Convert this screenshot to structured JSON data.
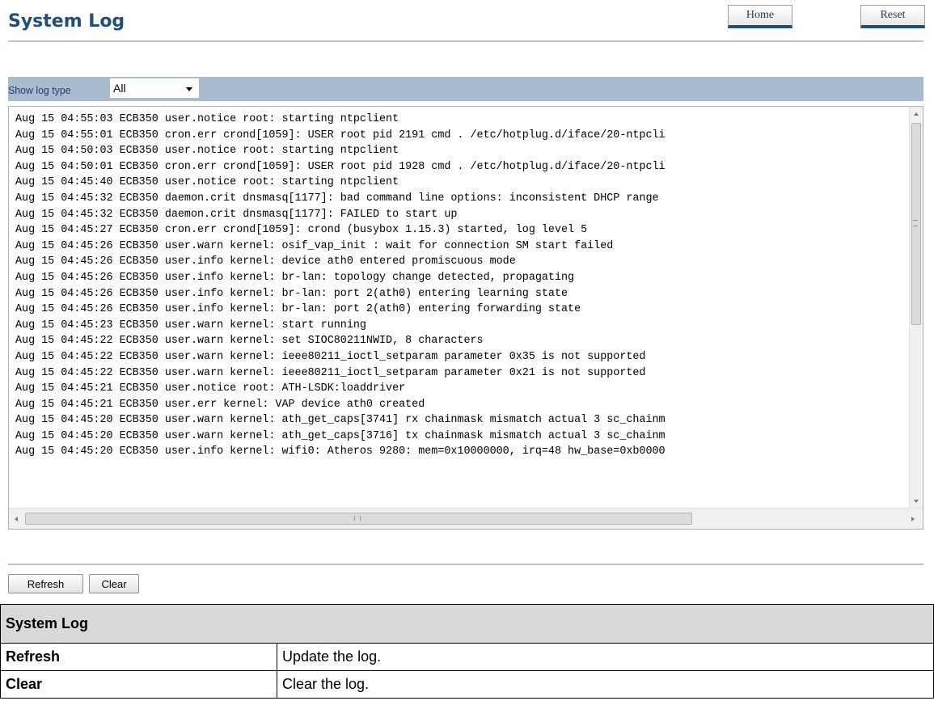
{
  "header": {
    "title": "System Log",
    "home_label": "Home",
    "reset_label": "Reset"
  },
  "filter": {
    "label": "Show log type",
    "selected": "All"
  },
  "log": {
    "lines": [
      "Aug 15 04:55:03 ECB350 user.notice root: starting ntpclient",
      "Aug 15 04:55:01 ECB350 cron.err crond[1059]: USER root pid 2191 cmd . /etc/hotplug.d/iface/20-ntpcli",
      "Aug 15 04:50:03 ECB350 user.notice root: starting ntpclient",
      "Aug 15 04:50:01 ECB350 cron.err crond[1059]: USER root pid 1928 cmd . /etc/hotplug.d/iface/20-ntpcli",
      "Aug 15 04:45:40 ECB350 user.notice root: starting ntpclient",
      "Aug 15 04:45:32 ECB350 daemon.crit dnsmasq[1177]: bad command line options: inconsistent DHCP range",
      "Aug 15 04:45:32 ECB350 daemon.crit dnsmasq[1177]: FAILED to start up",
      "Aug 15 04:45:27 ECB350 cron.err crond[1059]: crond (busybox 1.15.3) started, log level 5",
      "Aug 15 04:45:26 ECB350 user.warn kernel: osif_vap_init : wait for connection SM start failed",
      "Aug 15 04:45:26 ECB350 user.info kernel: device ath0 entered promiscuous mode",
      "Aug 15 04:45:26 ECB350 user.info kernel: br-lan: topology change detected, propagating",
      "Aug 15 04:45:26 ECB350 user.info kernel: br-lan: port 2(ath0) entering learning state",
      "Aug 15 04:45:26 ECB350 user.info kernel: br-lan: port 2(ath0) entering forwarding state",
      "Aug 15 04:45:23 ECB350 user.warn kernel: start running",
      "Aug 15 04:45:22 ECB350 user.warn kernel: set SIOC80211NWID, 8 characters",
      "Aug 15 04:45:22 ECB350 user.warn kernel: ieee80211_ioctl_setparam parameter 0x35 is not supported",
      "Aug 15 04:45:22 ECB350 user.warn kernel: ieee80211_ioctl_setparam parameter 0x21 is not supported",
      "Aug 15 04:45:21 ECB350 user.notice root: ATH-LSDK:loaddriver",
      "Aug 15 04:45:21 ECB350 user.err kernel: VAP device ath0 created",
      "Aug 15 04:45:20 ECB350 user.warn kernel: ath_get_caps[3741] rx chainmask mismatch actual 3 sc_chainm",
      "Aug 15 04:45:20 ECB350 user.warn kernel: ath_get_caps[3716] tx chainmask mismatch actual 3 sc_chainm",
      "Aug 15 04:45:20 ECB350 user.info kernel: wifi0: Atheros 9280: mem=0x10000000, irq=48 hw_base=0xb0000"
    ]
  },
  "actions": {
    "refresh_label": "Refresh",
    "clear_label": "Clear"
  },
  "table": {
    "title": "System Log",
    "rows": [
      {
        "key": "Refresh",
        "value": "Update the log."
      },
      {
        "key": "Clear",
        "value": "Clear the log."
      }
    ]
  },
  "colors": {
    "title": "#1f4e78",
    "filter_bar": "#a9bccf",
    "table_header": "#d9d9d9"
  },
  "icons": {
    "select_caret": "chevron-down-icon",
    "scroll_up": "arrow-up-icon",
    "scroll_down": "arrow-down-icon",
    "scroll_left": "arrow-left-icon",
    "scroll_right": "arrow-right-icon"
  }
}
